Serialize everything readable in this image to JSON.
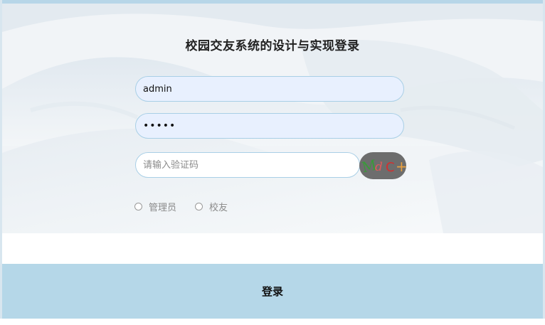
{
  "title": "校园交友系统的设计与实现登录",
  "username": {
    "value": "admin"
  },
  "password": {
    "value": "•••••"
  },
  "captcha_input": {
    "placeholder": "请输入验证码"
  },
  "captcha": {
    "text": [
      "M",
      "d",
      "C",
      "+"
    ],
    "colors": [
      "#3a9a3a",
      "#e05a5a",
      "#d23030",
      "#e8a040"
    ]
  },
  "roles": [
    {
      "label": "管理员",
      "checked": false
    },
    {
      "label": "校友",
      "checked": false
    }
  ],
  "login_button": {
    "label": "登录"
  },
  "colors": {
    "accent_bar": "#b5d7e8",
    "input_border": "#a9cfe6",
    "input_fill": "#e8f0fe",
    "captcha_bg": "#6d6d6d"
  }
}
